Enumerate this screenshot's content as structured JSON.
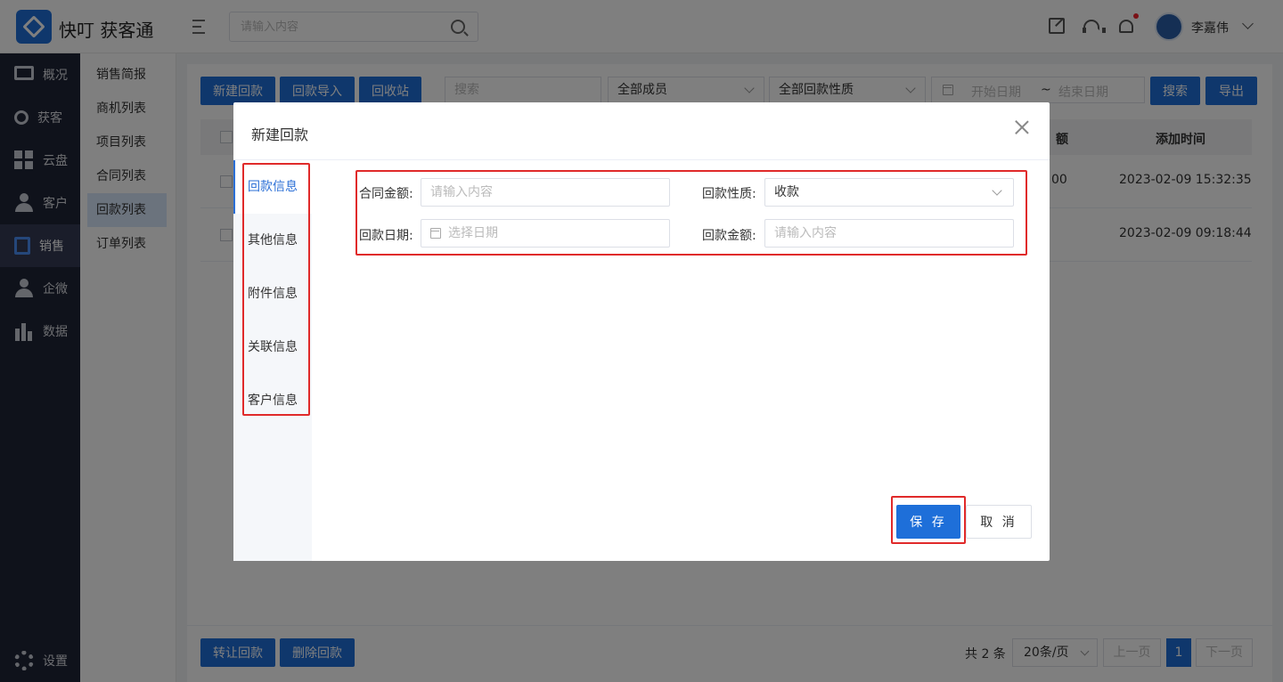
{
  "app": {
    "title": "快叮 获客通"
  },
  "header": {
    "search_placeholder": "请输入内容",
    "user_name": "李嘉伟"
  },
  "sidebar": {
    "items": [
      {
        "label": "概况",
        "icon": "monitor-icon"
      },
      {
        "label": "获客",
        "icon": "share-icon"
      },
      {
        "label": "云盘",
        "icon": "grid-icon"
      },
      {
        "label": "客户",
        "icon": "person-icon"
      },
      {
        "label": "销售",
        "icon": "clipboard-icon"
      },
      {
        "label": "企微",
        "icon": "person-icon"
      },
      {
        "label": "数据",
        "icon": "bar-chart-icon"
      }
    ],
    "settings_label": "设置",
    "active": "销售"
  },
  "subnav": {
    "items": [
      "销售简报",
      "商机列表",
      "项目列表",
      "合同列表",
      "回款列表",
      "订单列表"
    ],
    "active": "回款列表"
  },
  "toolbar": {
    "new_button": "新建回款",
    "import_button": "回款导入",
    "recycle_button": "回收站",
    "search_placeholder": "搜索",
    "member_select": "全部成员",
    "nature_select": "全部回款性质",
    "date_start_placeholder": "开始日期",
    "date_sep": "~",
    "date_end_placeholder": "结束日期",
    "search_button": "搜索",
    "export_button": "导出"
  },
  "table": {
    "headers": {
      "amount_partial": "额",
      "added_time": "添加时间"
    },
    "rows": [
      {
        "amount_partial": "00",
        "added_time": "2023-02-09 15:32:35"
      },
      {
        "amount_partial": "",
        "added_time": "2023-02-09 09:18:44"
      }
    ]
  },
  "footer": {
    "transfer_button": "转让回款",
    "delete_button": "删除回款",
    "total": "共 2 条",
    "page_size": "20条/页",
    "prev": "上一页",
    "current_page": "1",
    "next": "下一页"
  },
  "modal": {
    "title": "新建回款",
    "tabs": [
      "回款信息",
      "其他信息",
      "附件信息",
      "关联信息",
      "客户信息"
    ],
    "active_tab": "回款信息",
    "form": {
      "contract_amount_label": "合同金额:",
      "contract_amount_placeholder": "请输入内容",
      "nature_label": "回款性质:",
      "nature_value": "收款",
      "date_label": "回款日期:",
      "date_placeholder": "选择日期",
      "payment_amount_label": "回款金额:",
      "payment_amount_placeholder": "请输入内容"
    },
    "save_button": "保 存",
    "cancel_button": "取 消"
  },
  "colors": {
    "primary": "#1e6fd9",
    "sidebar_bg": "#1f2436",
    "highlight": "#e02a2a"
  }
}
